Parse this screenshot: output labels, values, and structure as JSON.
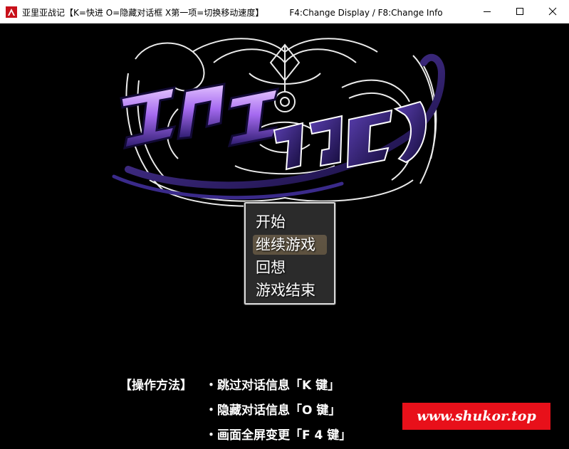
{
  "window": {
    "title": "亚里亚战记【K=快进 O=隐藏对话框 X第一项=切换移动速度】",
    "hint": "F4:Change Display / F8:Change Info",
    "icon": "app-icon",
    "controls": {
      "minimize_icon": "minimize-icon",
      "maximize_icon": "maximize-icon",
      "close_icon": "close-icon"
    }
  },
  "title_menu": {
    "items": [
      {
        "label": "开始",
        "selected": false
      },
      {
        "label": "继续游戏",
        "selected": true
      },
      {
        "label": "回想",
        "selected": false
      },
      {
        "label": "游戏结束",
        "selected": false
      }
    ]
  },
  "controls_help": {
    "header": "【操作方法】",
    "lines": [
      "・跳过对话信息「K 键」",
      "・隐藏对话信息「O 键」",
      "・画面全屏变更「F 4 键」"
    ]
  },
  "watermark": {
    "text": "www.shukor.top",
    "color": "#e8101a"
  },
  "colors": {
    "background": "#000000",
    "menu_border": "#d9d9d9",
    "logo_purple": "#b07cff",
    "logo_dark": "#2a1a6a"
  }
}
